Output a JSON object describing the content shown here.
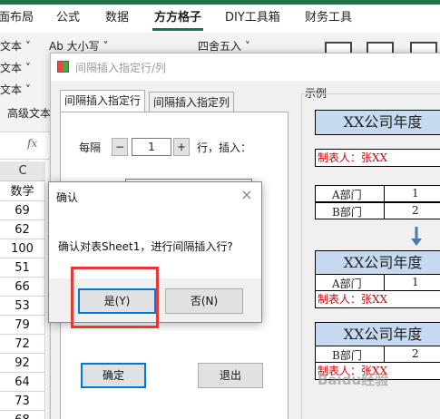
{
  "ribbon": {
    "tabs": [
      "面布局",
      "公式",
      "数据",
      "方方格子",
      "DIY工具箱",
      "财务工具"
    ],
    "active_tab": "方方格子",
    "items": {
      "text1": "文本 ˅",
      "text2": "文本 ˅",
      "text3": "文本 ˅",
      "case": "Ab 大小写 ˅",
      "round": "四舍五入 ˅",
      "advanced": "高级文本"
    }
  },
  "sheet": {
    "fx": "fx",
    "column_header": "C",
    "header_cell": "数学",
    "values": [
      "69",
      "62",
      "100",
      "51",
      "66",
      "53",
      "79",
      "72",
      "92",
      "64",
      "73",
      "68"
    ]
  },
  "main_dialog": {
    "title": "间隔插入指定行/列",
    "tabs": [
      "间隔插入指定行",
      "间隔插入指定列"
    ],
    "every_label": "每隔",
    "minus": "−",
    "count": "1",
    "plus": "+",
    "row_insert_label": "行，插入：",
    "ok_label": "确定",
    "exit_label": "退出"
  },
  "example": {
    "label": "示例",
    "title": "XX公司年度",
    "maker": "制表人：张XX",
    "dept_a": "A部门",
    "dept_b": "B部门",
    "one": "1",
    "two": "2"
  },
  "confirm_dialog": {
    "title": "确认",
    "close": "×",
    "message": "确认对表Sheet1，进行间隔插入行?",
    "yes": "是(Y)",
    "no": "否(N)"
  },
  "watermark": "Baidu经验",
  "colors": {
    "excel_green": "#217346",
    "highlight_red": "#e53935",
    "example_blue": "#c5d9f1",
    "maker_red": "#d00000",
    "focus_blue": "#0078d7"
  }
}
